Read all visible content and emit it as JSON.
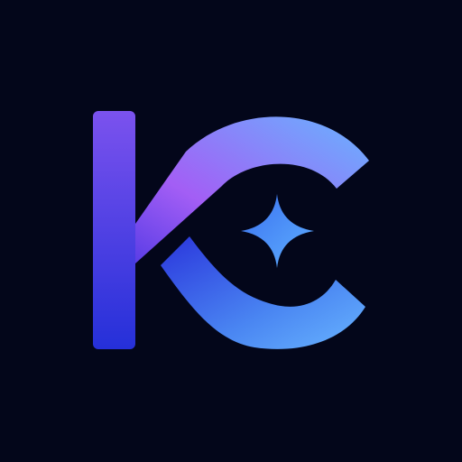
{
  "background_color": "#03061a",
  "logo": {
    "icon_name": "kc-monogram-icon",
    "accent_icon_name": "four-point-star-icon",
    "colors": {
      "gradient_purple": "#a35ef5",
      "gradient_blue": "#3a42e0",
      "gradient_deep_blue": "#2530d9",
      "gradient_light_blue": "#68b4ff",
      "star_light": "#5fb0ff",
      "star_deep": "#3a70f0"
    }
  }
}
